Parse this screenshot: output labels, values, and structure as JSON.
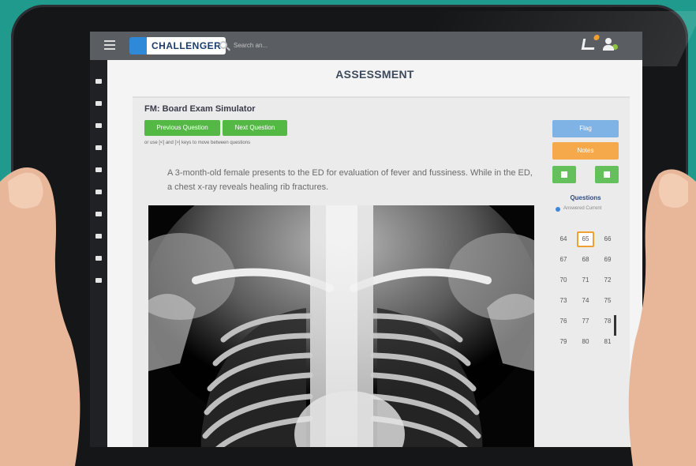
{
  "app": {
    "logo_text": "CHALLENGER",
    "search_placeholder": "Search an..."
  },
  "page": {
    "title": "ASSESSMENT"
  },
  "exam": {
    "title": "FM: Board Exam Simulator",
    "previous_label": "Previous Question",
    "next_label": "Next Question",
    "hint": "or use [<] and [>] keys to move between questions",
    "question_text": "A 3-month-old female presents to the ED for evaluation of fever and fussiness. While in the ED, a chest x-ray reveals healing rib fractures."
  },
  "right_panel": {
    "flag_label": "Flag",
    "notes_label": "Notes",
    "questions_heading": "Questions",
    "legend_label": "Answered Current",
    "current_question": "65",
    "question_rows": [
      [
        "64",
        "65",
        "66"
      ],
      [
        "67",
        "68",
        "69"
      ],
      [
        "70",
        "71",
        "72"
      ],
      [
        "73",
        "74",
        "75"
      ],
      [
        "76",
        "77",
        "78"
      ],
      [
        "79",
        "80",
        "81"
      ]
    ]
  },
  "colors": {
    "background": "#1f9a8c",
    "topbar": "#5a5d62",
    "green_button": "#54b845",
    "flag_button": "#7fb2e5",
    "notes_button": "#f6a94a",
    "current_outline": "#f0a030"
  },
  "icons": [
    "hamburger-icon",
    "search-icon",
    "cart-icon",
    "user-icon",
    "save-icon",
    "next-icon"
  ]
}
